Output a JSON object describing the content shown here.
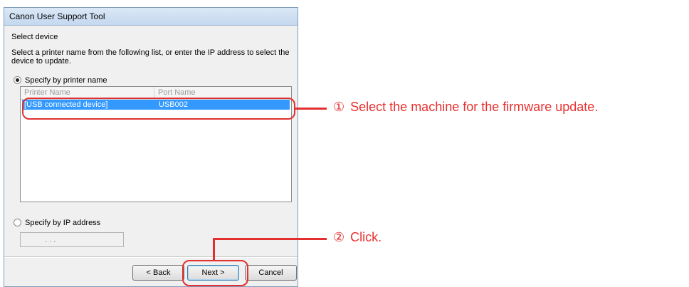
{
  "window": {
    "title": "Canon User Support Tool"
  },
  "section_heading": "Select device",
  "instruction_line1": "Select a printer name from the following list, or enter the IP address to select the",
  "instruction_line2": "device to update.",
  "radio_printer_name": {
    "label": "Specify by printer name",
    "selected": true
  },
  "device_list": {
    "columns": [
      "Printer Name",
      "Port Name"
    ],
    "rows": [
      {
        "printer": "[USB connected device]",
        "port": "USB002",
        "selected": true
      }
    ]
  },
  "radio_ip": {
    "label": "Specify by IP address",
    "selected": false
  },
  "ip_field": {
    "value": ". . ."
  },
  "buttons": {
    "back": "< Back",
    "next": "Next >",
    "cancel": "Cancel"
  },
  "annotations": [
    {
      "number": "①",
      "text": "Select the machine for the firmware update."
    },
    {
      "number": "②",
      "text": "Click."
    }
  ],
  "colors": {
    "annotation_red": "#e23030",
    "selection_blue": "#3399ff"
  }
}
